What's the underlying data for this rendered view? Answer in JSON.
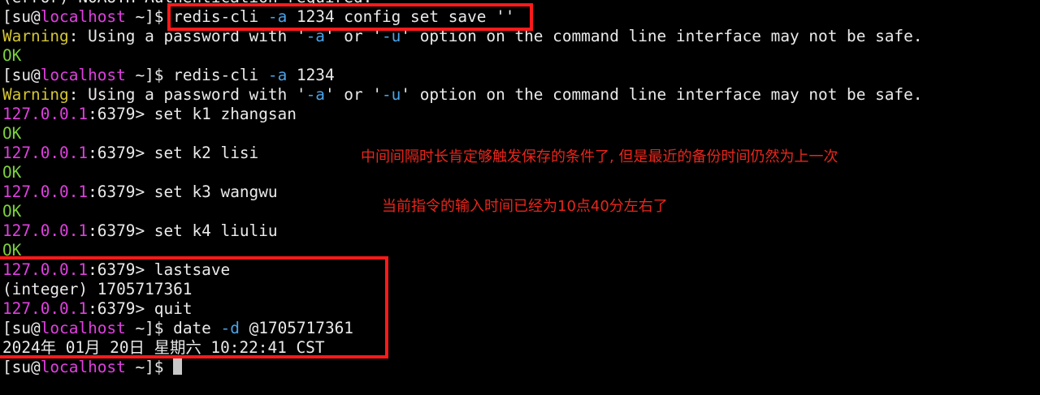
{
  "top_partial": "(error) NOAUTH Authentication required.",
  "lines": [
    {
      "segs": [
        {
          "t": "[su@",
          "c": "w"
        },
        {
          "t": "localhost",
          "c": "mag"
        },
        {
          "t": " ~]$ redis-cli ",
          "c": "w"
        },
        {
          "t": "-a",
          "c": "blu"
        },
        {
          "t": " 1234 config set save ''",
          "c": "w"
        }
      ]
    },
    {
      "segs": [
        {
          "t": "Warning",
          "c": "yel"
        },
        {
          "t": ": Using a password with '",
          "c": "w"
        },
        {
          "t": "-a",
          "c": "blu"
        },
        {
          "t": "' or '",
          "c": "w"
        },
        {
          "t": "-u",
          "c": "blu"
        },
        {
          "t": "' option on the command line interface may not be safe.",
          "c": "w"
        }
      ]
    },
    {
      "segs": [
        {
          "t": "OK",
          "c": "grn"
        }
      ]
    },
    {
      "segs": [
        {
          "t": "[su@",
          "c": "w"
        },
        {
          "t": "localhost",
          "c": "mag"
        },
        {
          "t": " ~]$ redis-cli ",
          "c": "w"
        },
        {
          "t": "-a",
          "c": "blu"
        },
        {
          "t": " 1234",
          "c": "w"
        }
      ]
    },
    {
      "segs": [
        {
          "t": "Warning",
          "c": "yel"
        },
        {
          "t": ": Using a password with '",
          "c": "w"
        },
        {
          "t": "-a",
          "c": "blu"
        },
        {
          "t": "' or '",
          "c": "w"
        },
        {
          "t": "-u",
          "c": "blu"
        },
        {
          "t": "' option on the command line interface may not be safe.",
          "c": "w"
        }
      ]
    },
    {
      "segs": [
        {
          "t": "127.0.0.1",
          "c": "mag"
        },
        {
          "t": ":6379> set k1 zhangsan",
          "c": "w"
        }
      ]
    },
    {
      "segs": [
        {
          "t": "OK",
          "c": "grn"
        }
      ]
    },
    {
      "segs": [
        {
          "t": "127.0.0.1",
          "c": "mag"
        },
        {
          "t": ":6379> set k2 lisi",
          "c": "w"
        }
      ]
    },
    {
      "segs": [
        {
          "t": "OK",
          "c": "grn"
        }
      ]
    },
    {
      "segs": [
        {
          "t": "127.0.0.1",
          "c": "mag"
        },
        {
          "t": ":6379> set k3 wangwu",
          "c": "w"
        }
      ]
    },
    {
      "segs": [
        {
          "t": "OK",
          "c": "grn"
        }
      ]
    },
    {
      "segs": [
        {
          "t": "127.0.0.1",
          "c": "mag"
        },
        {
          "t": ":6379> set k4 liuliu",
          "c": "w"
        }
      ]
    },
    {
      "segs": [
        {
          "t": "OK",
          "c": "grn"
        }
      ]
    },
    {
      "segs": [
        {
          "t": "127.0.0.1",
          "c": "mag"
        },
        {
          "t": ":6379> lastsave",
          "c": "w"
        }
      ]
    },
    {
      "segs": [
        {
          "t": "(integer) 1705717361",
          "c": "w"
        }
      ]
    },
    {
      "segs": [
        {
          "t": "127.0.0.1",
          "c": "mag"
        },
        {
          "t": ":6379> quit",
          "c": "w"
        }
      ]
    },
    {
      "segs": [
        {
          "t": "[su@",
          "c": "w"
        },
        {
          "t": "localhost",
          "c": "mag"
        },
        {
          "t": " ~]$ date ",
          "c": "w"
        },
        {
          "t": "-d",
          "c": "blu"
        },
        {
          "t": " @1705717361",
          "c": "w"
        }
      ]
    },
    {
      "segs": [
        {
          "t": "2024年 01月 20日 星期六 10:22:41 CST",
          "c": "w"
        }
      ]
    },
    {
      "segs": [
        {
          "t": "[su@",
          "c": "w"
        },
        {
          "t": "localhost",
          "c": "mag"
        },
        {
          "t": " ~]$ ",
          "c": "w"
        }
      ],
      "cursor": true
    }
  ],
  "annotations": {
    "note_1": "中间间隔时长肯定够触发保存的条件了, 但是最近的备份时间仍然为上一次",
    "note_2": "当前指令的输入时间已经为10点40分左右了"
  },
  "colors": {
    "background": "#000000",
    "text": "#eaeaea",
    "host_magenta": "#e040e0",
    "ok_green": "#7cd03c",
    "flag_blue": "#4aa3e8",
    "warning_yellow": "#d4c534",
    "highlight_red": "#ff1a1a",
    "note_red": "#e8261c"
  }
}
